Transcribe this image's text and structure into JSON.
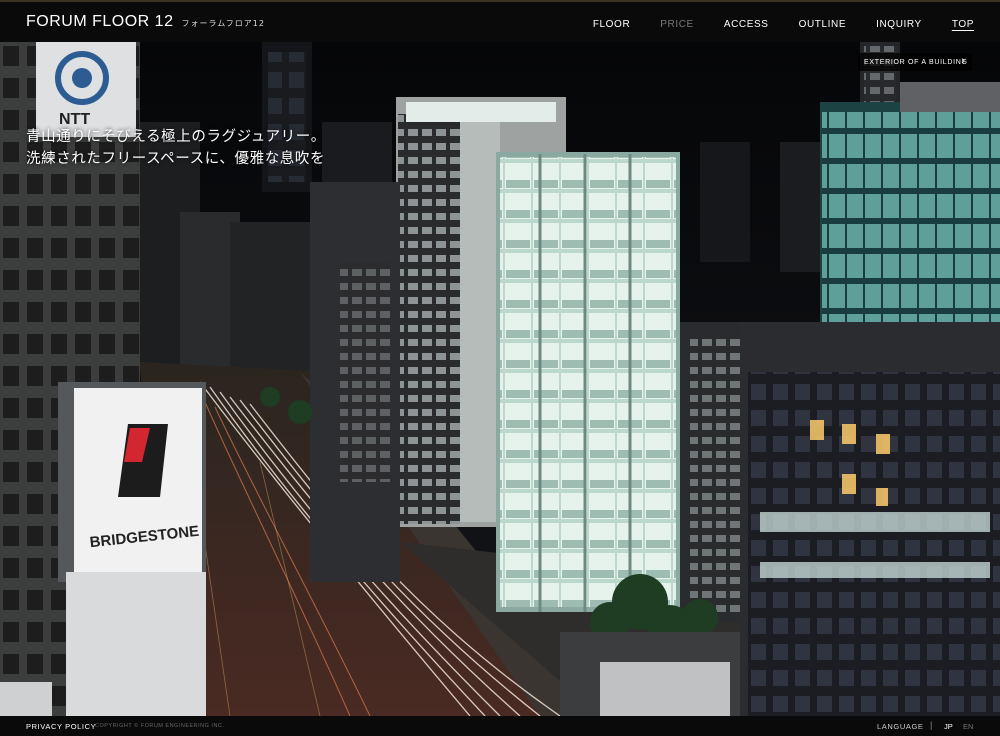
{
  "header": {
    "logo_main": "FORUM FLOOR 12",
    "logo_sub": "フォーラムフロア12"
  },
  "nav": {
    "items": [
      {
        "label": "FLOOR",
        "state": "normal"
      },
      {
        "label": "PRICE",
        "state": "dimmed"
      },
      {
        "label": "ACCESS",
        "state": "normal"
      },
      {
        "label": "OUTLINE",
        "state": "normal"
      },
      {
        "label": "INQUIRY",
        "state": "normal"
      },
      {
        "label": "TOP",
        "state": "current"
      }
    ]
  },
  "hero": {
    "catch_line1": "青山通りにそびえる極上のラグジュアリー。",
    "catch_line2": "洗練されたフリースペースに、優雅な息吹を",
    "signs": {
      "ntt": "NTT",
      "bridgestone": "BRIDGESTONE"
    },
    "exterior_button": {
      "label": "EXTERIOR OF A BUILDING",
      "icon": "chevron-right-icon"
    }
  },
  "footer": {
    "privacy_policy": "PRIVACY POLICY",
    "copyright": "COPYRIGHT © FORUM ENGINEERING INC.",
    "language_label": "LANGUAGE",
    "separator": "|",
    "lang_jp": "JP",
    "lang_en": "EN"
  },
  "colors": {
    "bar_bg": "#0a0a0a",
    "nav_text": "#ffffff",
    "nav_dimmed": "#777777",
    "building_glow": "#dfeee8"
  }
}
